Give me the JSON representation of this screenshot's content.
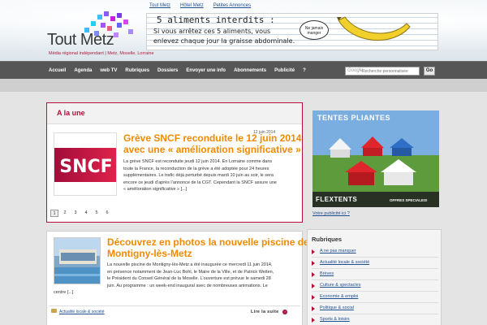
{
  "colors": {
    "accent": "#b0123a",
    "link": "#1f4f91",
    "title_orange": "#f08a00",
    "nav_bg": "#565656"
  },
  "top_links": [
    "Tout Metz",
    "Hôtel Metz",
    "Petites Annonces"
  ],
  "logo": {
    "title": "Tout Metz",
    "subtitle": "Média régional indépendant | Metz, Moselle, Lorraine"
  },
  "banner": {
    "title": "5 aliments interdits :",
    "line1": "Si vous arrêtez ces 5 aliments, vous",
    "line2": "enlevez chaque jour la graisse abdominale.",
    "badge": "Ne jamais manger"
  },
  "nav": {
    "items": [
      "Accueil",
      "Agenda",
      "web TV",
      "Rubriques",
      "Dossiers",
      "Envoyer une info",
      "Abonnements",
      "Publicité",
      "?"
    ],
    "search_placeholder": "Recherche personnalisée",
    "search_brand": "Google",
    "go_label": "Go"
  },
  "featured": {
    "heading": "A la une",
    "article": {
      "title_line1": "Grève SNCF reconduite le 12 juin 2014",
      "title_line2": "avec une « amélioration significative »",
      "date": "12 juin 2014",
      "body": [
        "La grève SNCF est reconduite jeudi 12 juin 2014. En Lorraine comme dans",
        "toute la France, la reconduction de la grève a été adoptée pour 24 heures",
        "supplémentaires. Le trafic déjà perturbé depuis mardi 10 juin au soir, le sera",
        "encore ce jeudi d’après l’annonce de la CGT. Cependant la SNCF assure une",
        "« amélioration significative » [...]"
      ],
      "image_text": "SNCF"
    },
    "pages": [
      "1",
      "2",
      "3",
      "4",
      "5",
      "6"
    ],
    "active_page": "1"
  },
  "article2": {
    "title_line1": "Découvrez en photos la nouvelle piscine de",
    "title_line2": "Montigny-lès-Metz",
    "body": [
      "La nouvelle piscine de Montigny-lès-Metz a été inaugurée ce mercredi 11 juin 2014,",
      "en présence notamment de Jean-Luc Bohl, le Maire de la Ville, et de Patrick Weiten,",
      "le Président du Conseil Général de la Moselle. L’ouverture est prévue le samedi 28",
      "juin. Au programme : un week-end inaugural avec de nombreuses animations. Le",
      "centre [...]"
    ],
    "category": "Actualité locale & société",
    "read_more": "Lire la suite"
  },
  "ad": {
    "title": "TENTES PLIANTES",
    "brand": "FLEXTENTS",
    "offer": "OFFRES SPECIALES!",
    "link": "Votre publicité ici ?"
  },
  "rubriques": {
    "heading": "Rubriques",
    "items": [
      "A ne pas manquer",
      "Actualité locale & société",
      "Brèves",
      "Culture & spectacles",
      "Economie & emploi",
      "Politique & social",
      "Sports & loisirs"
    ]
  }
}
